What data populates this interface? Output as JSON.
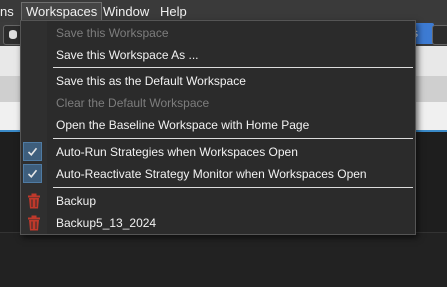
{
  "menubar": {
    "items": [
      "ns",
      "Workspaces",
      "Window",
      "Help"
    ]
  },
  "toolbar": {
    "right_button_label": "ets"
  },
  "workspaces_menu": {
    "items": [
      {
        "label": "Save this Workspace",
        "enabled": false
      },
      {
        "label": "Save this Workspace As ...",
        "enabled": true
      },
      {
        "label": "Save this as the Default Workspace",
        "enabled": true
      },
      {
        "label": "Clear the Default Workspace",
        "enabled": false
      },
      {
        "label": "Open the Baseline Workspace with Home Page",
        "enabled": true
      },
      {
        "label": "Auto-Run Strategies when Workspaces Open",
        "enabled": true,
        "checked": true
      },
      {
        "label": "Auto-Reactivate Strategy Monitor when Workspaces Open",
        "enabled": true,
        "checked": true
      },
      {
        "label": "Backup",
        "enabled": true,
        "icon": "trash-icon"
      },
      {
        "label": "Backup5_13_2024",
        "enabled": true,
        "icon": "trash-icon"
      }
    ]
  },
  "colors": {
    "accent": "#3d7bd3",
    "menu_bg": "#2b2b2b",
    "check_bg": "#3e5e7c",
    "trash_red": "#c0392b"
  }
}
